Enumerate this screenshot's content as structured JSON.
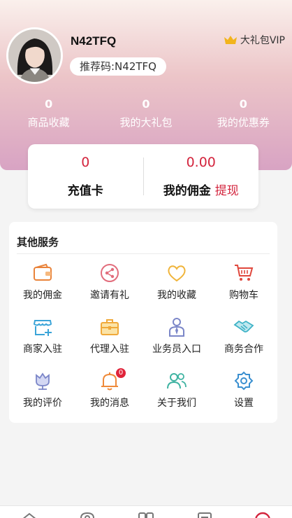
{
  "user": {
    "name": "N42TFQ",
    "referral_code": "推荐码:N42TFQ",
    "vip_label": "大礼包VIP"
  },
  "stats": [
    {
      "value": "0",
      "label": "商品收藏"
    },
    {
      "value": "0",
      "label": "我的大礼包"
    },
    {
      "value": "0",
      "label": "我的优惠券"
    }
  ],
  "wallet": {
    "recharge_value": "0",
    "recharge_label": "充值卡",
    "commission_value": "0.00",
    "commission_label": "我的佣金",
    "withdraw_label": "提现"
  },
  "services": {
    "title": "其他服务",
    "items": [
      {
        "label": "我的佣金",
        "icon": "wallet-icon"
      },
      {
        "label": "邀请有礼",
        "icon": "share-icon"
      },
      {
        "label": "我的收藏",
        "icon": "heart-icon"
      },
      {
        "label": "购物车",
        "icon": "cart-icon"
      },
      {
        "label": "商家入驻",
        "icon": "store-icon"
      },
      {
        "label": "代理入驻",
        "icon": "briefcase-icon"
      },
      {
        "label": "业务员入口",
        "icon": "salesman-icon"
      },
      {
        "label": "商务合作",
        "icon": "handshake-icon"
      },
      {
        "label": "我的评价",
        "icon": "flower-icon"
      },
      {
        "label": "我的消息",
        "icon": "bell-icon",
        "badge": "0"
      },
      {
        "label": "关于我们",
        "icon": "people-icon"
      },
      {
        "label": "设置",
        "icon": "settings-icon"
      }
    ]
  },
  "tabbar": {
    "icons": [
      "home-icon",
      "location-icon",
      "category-icon",
      "orders-icon",
      "profile-icon"
    ]
  },
  "colors": {
    "accent": "#d3243d",
    "header_top": "#faf0ec",
    "header_bottom": "#d8a3c3"
  }
}
